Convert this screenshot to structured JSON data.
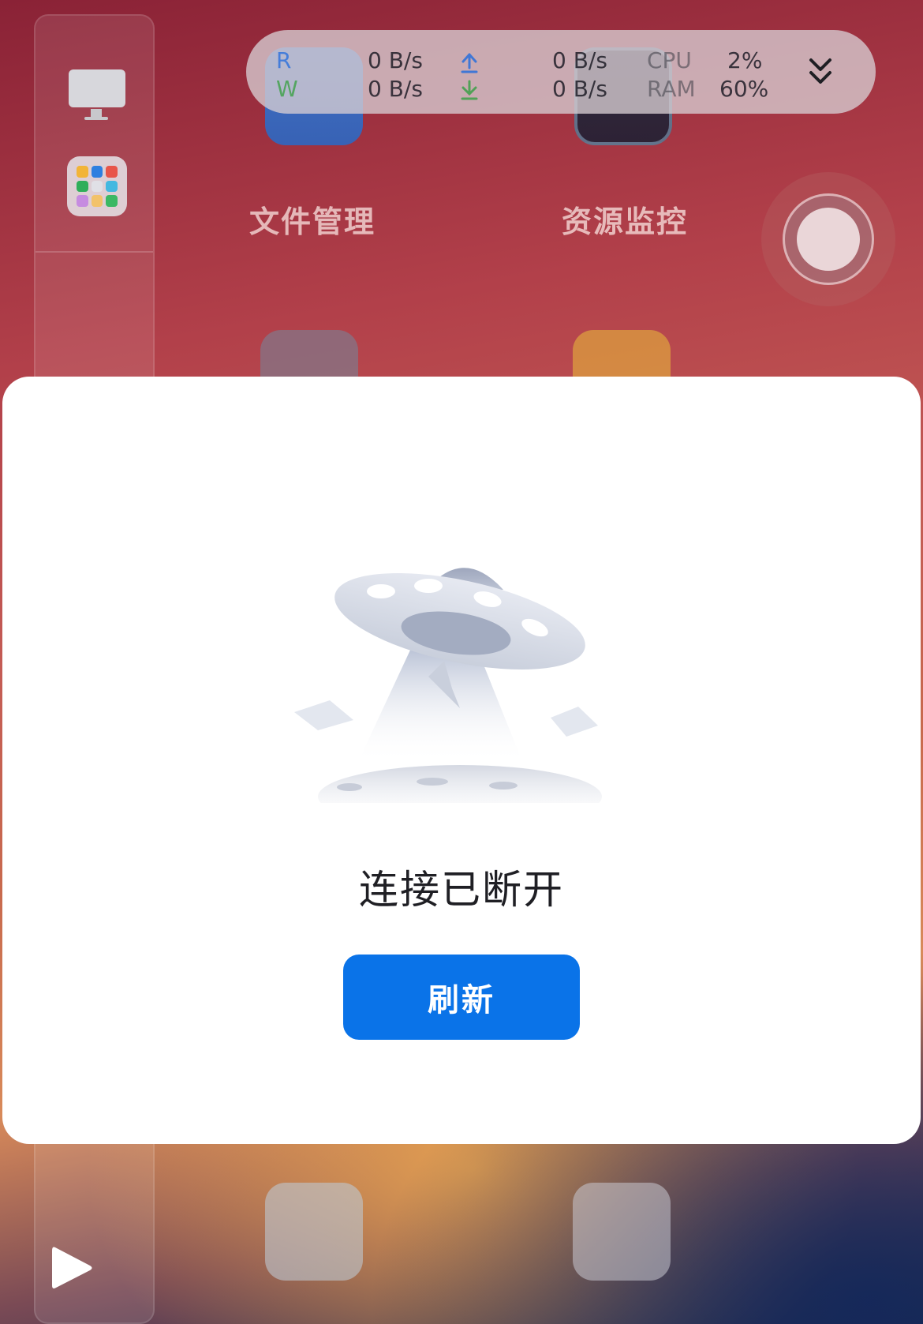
{
  "status_bar": {
    "read_label": "R",
    "write_label": "W",
    "read_rate": "0  B/s",
    "write_rate": "0  B/s",
    "upload_rate": "0  B/s",
    "download_rate": "0  B/s",
    "cpu_label": "CPU",
    "cpu_value": "2%",
    "ram_label": "RAM",
    "ram_value": "60%"
  },
  "desktop_apps": [
    {
      "label": "文件管理",
      "icon": "folder-icon"
    },
    {
      "label": "资源监控",
      "icon": "monitor-icon"
    }
  ],
  "dialog": {
    "message": "连接已断开",
    "refresh_button": "刷新"
  },
  "colors": {
    "primary_button": "#0a73e8",
    "dialog_bg": "#ffffff",
    "upload_arrow": "#286edc",
    "download_arrow": "#3ca046"
  }
}
